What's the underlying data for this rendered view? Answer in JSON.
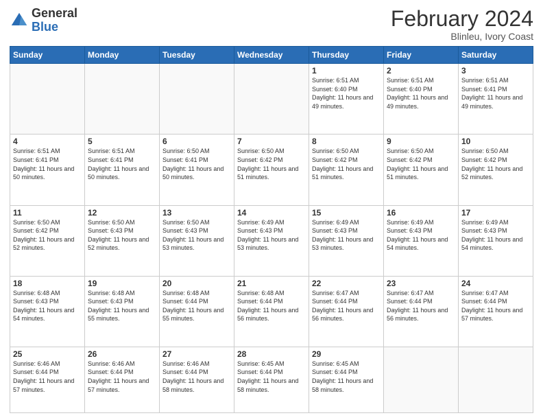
{
  "header": {
    "logo_general": "General",
    "logo_blue": "Blue",
    "month_title": "February 2024",
    "location": "Blinleu, Ivory Coast"
  },
  "days_of_week": [
    "Sunday",
    "Monday",
    "Tuesday",
    "Wednesday",
    "Thursday",
    "Friday",
    "Saturday"
  ],
  "weeks": [
    [
      {
        "day": "",
        "info": ""
      },
      {
        "day": "",
        "info": ""
      },
      {
        "day": "",
        "info": ""
      },
      {
        "day": "",
        "info": ""
      },
      {
        "day": "1",
        "info": "Sunrise: 6:51 AM\nSunset: 6:40 PM\nDaylight: 11 hours and 49 minutes."
      },
      {
        "day": "2",
        "info": "Sunrise: 6:51 AM\nSunset: 6:40 PM\nDaylight: 11 hours and 49 minutes."
      },
      {
        "day": "3",
        "info": "Sunrise: 6:51 AM\nSunset: 6:41 PM\nDaylight: 11 hours and 49 minutes."
      }
    ],
    [
      {
        "day": "4",
        "info": "Sunrise: 6:51 AM\nSunset: 6:41 PM\nDaylight: 11 hours and 50 minutes."
      },
      {
        "day": "5",
        "info": "Sunrise: 6:51 AM\nSunset: 6:41 PM\nDaylight: 11 hours and 50 minutes."
      },
      {
        "day": "6",
        "info": "Sunrise: 6:50 AM\nSunset: 6:41 PM\nDaylight: 11 hours and 50 minutes."
      },
      {
        "day": "7",
        "info": "Sunrise: 6:50 AM\nSunset: 6:42 PM\nDaylight: 11 hours and 51 minutes."
      },
      {
        "day": "8",
        "info": "Sunrise: 6:50 AM\nSunset: 6:42 PM\nDaylight: 11 hours and 51 minutes."
      },
      {
        "day": "9",
        "info": "Sunrise: 6:50 AM\nSunset: 6:42 PM\nDaylight: 11 hours and 51 minutes."
      },
      {
        "day": "10",
        "info": "Sunrise: 6:50 AM\nSunset: 6:42 PM\nDaylight: 11 hours and 52 minutes."
      }
    ],
    [
      {
        "day": "11",
        "info": "Sunrise: 6:50 AM\nSunset: 6:42 PM\nDaylight: 11 hours and 52 minutes."
      },
      {
        "day": "12",
        "info": "Sunrise: 6:50 AM\nSunset: 6:43 PM\nDaylight: 11 hours and 52 minutes."
      },
      {
        "day": "13",
        "info": "Sunrise: 6:50 AM\nSunset: 6:43 PM\nDaylight: 11 hours and 53 minutes."
      },
      {
        "day": "14",
        "info": "Sunrise: 6:49 AM\nSunset: 6:43 PM\nDaylight: 11 hours and 53 minutes."
      },
      {
        "day": "15",
        "info": "Sunrise: 6:49 AM\nSunset: 6:43 PM\nDaylight: 11 hours and 53 minutes."
      },
      {
        "day": "16",
        "info": "Sunrise: 6:49 AM\nSunset: 6:43 PM\nDaylight: 11 hours and 54 minutes."
      },
      {
        "day": "17",
        "info": "Sunrise: 6:49 AM\nSunset: 6:43 PM\nDaylight: 11 hours and 54 minutes."
      }
    ],
    [
      {
        "day": "18",
        "info": "Sunrise: 6:48 AM\nSunset: 6:43 PM\nDaylight: 11 hours and 54 minutes."
      },
      {
        "day": "19",
        "info": "Sunrise: 6:48 AM\nSunset: 6:43 PM\nDaylight: 11 hours and 55 minutes."
      },
      {
        "day": "20",
        "info": "Sunrise: 6:48 AM\nSunset: 6:44 PM\nDaylight: 11 hours and 55 minutes."
      },
      {
        "day": "21",
        "info": "Sunrise: 6:48 AM\nSunset: 6:44 PM\nDaylight: 11 hours and 56 minutes."
      },
      {
        "day": "22",
        "info": "Sunrise: 6:47 AM\nSunset: 6:44 PM\nDaylight: 11 hours and 56 minutes."
      },
      {
        "day": "23",
        "info": "Sunrise: 6:47 AM\nSunset: 6:44 PM\nDaylight: 11 hours and 56 minutes."
      },
      {
        "day": "24",
        "info": "Sunrise: 6:47 AM\nSunset: 6:44 PM\nDaylight: 11 hours and 57 minutes."
      }
    ],
    [
      {
        "day": "25",
        "info": "Sunrise: 6:46 AM\nSunset: 6:44 PM\nDaylight: 11 hours and 57 minutes."
      },
      {
        "day": "26",
        "info": "Sunrise: 6:46 AM\nSunset: 6:44 PM\nDaylight: 11 hours and 57 minutes."
      },
      {
        "day": "27",
        "info": "Sunrise: 6:46 AM\nSunset: 6:44 PM\nDaylight: 11 hours and 58 minutes."
      },
      {
        "day": "28",
        "info": "Sunrise: 6:45 AM\nSunset: 6:44 PM\nDaylight: 11 hours and 58 minutes."
      },
      {
        "day": "29",
        "info": "Sunrise: 6:45 AM\nSunset: 6:44 PM\nDaylight: 11 hours and 58 minutes."
      },
      {
        "day": "",
        "info": ""
      },
      {
        "day": "",
        "info": ""
      }
    ]
  ]
}
